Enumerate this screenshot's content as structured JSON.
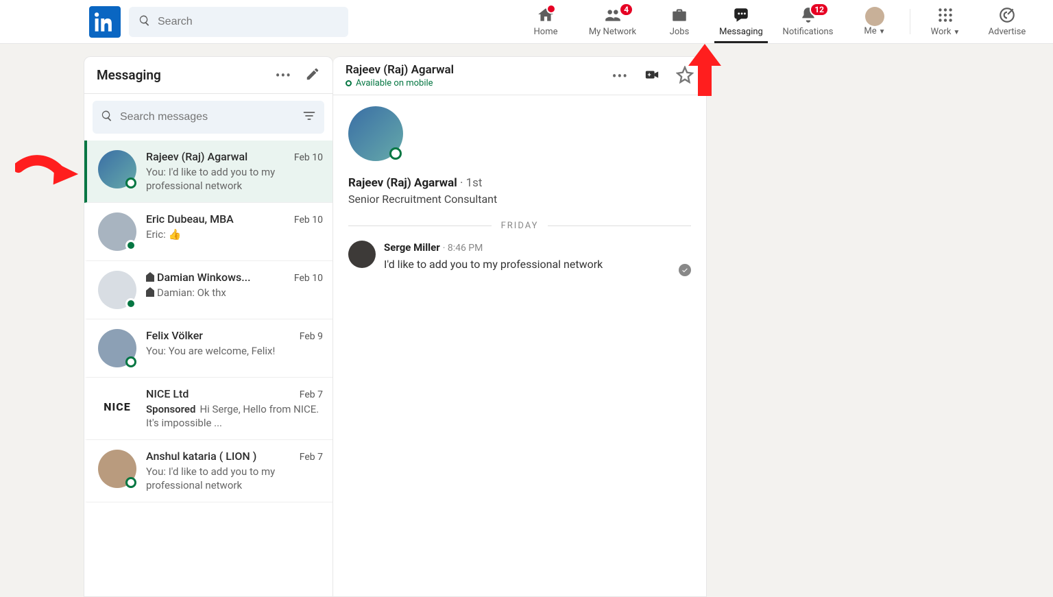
{
  "topbar": {
    "search_placeholder": "Search",
    "nav": {
      "home": {
        "label": "Home",
        "badge": null
      },
      "network": {
        "label": "My Network",
        "badge": "4"
      },
      "jobs": {
        "label": "Jobs",
        "badge": null
      },
      "messaging": {
        "label": "Messaging",
        "badge": null
      },
      "notifications": {
        "label": "Notifications",
        "badge": "12"
      },
      "me": {
        "label": "Me"
      },
      "work": {
        "label": "Work"
      },
      "advertise": {
        "label": "Advertise"
      }
    }
  },
  "left": {
    "title": "Messaging",
    "search_placeholder": "Search messages",
    "threads": [
      {
        "name": "Rajeev (Raj) Agarwal",
        "date": "Feb 10",
        "preview": "You: I'd like to add you to my professional network",
        "presence": "ring",
        "selected": true
      },
      {
        "name": "Eric Dubeau, MBA",
        "date": "Feb 10",
        "preview": "Eric: 👍",
        "presence": "dot",
        "selected": false
      },
      {
        "name": "Damian Winkows...",
        "date": "Feb 10",
        "preview": "Damian: Ok thx",
        "presence": "dot",
        "selected": false,
        "inmail": true
      },
      {
        "name": "Felix Völker",
        "date": "Feb 9",
        "preview": "You: You are welcome, Felix!",
        "presence": "ring",
        "selected": false
      },
      {
        "name": "NICE Ltd",
        "date": "Feb 7",
        "preview": "Hi Serge, Hello from NICE. It's impossible ...",
        "sponsored": "Sponsored",
        "square": "NICE",
        "selected": false
      },
      {
        "name": "Anshul kataria ( LION )",
        "date": "Feb 7",
        "preview": "You: I'd like to add you to my professional network",
        "presence": "ring",
        "selected": false
      }
    ]
  },
  "conv": {
    "header_name": "Rajeev (Raj) Agarwal",
    "header_status": "Available on mobile",
    "profile_name": "Rajeev (Raj) Agarwal",
    "profile_degree": " · 1st",
    "profile_role": "Senior Recruitment Consultant",
    "day_divider": "FRIDAY",
    "msg_from": "Serge Miller",
    "msg_time": " · 8:46 PM",
    "msg_text": "I'd like to add you to my professional network"
  }
}
